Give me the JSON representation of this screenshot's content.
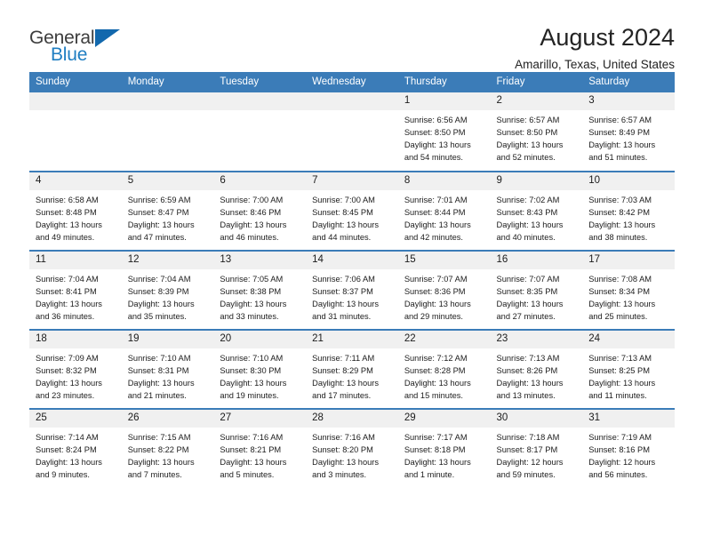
{
  "brand": {
    "name_top": "General",
    "name_bottom": "Blue",
    "triangle_color": "#1268ad",
    "blue_color": "#1f7ec2"
  },
  "header": {
    "title": "August 2024",
    "location": "Amarillo, Texas, United States"
  },
  "theme": {
    "header_bg": "#3b7cb8",
    "header_text": "#ffffff",
    "daynum_bg": "#f0f0f0",
    "cell_bg": "#ffffff",
    "rule_color": "#3b7cb8"
  },
  "calendar": {
    "weekday_headers": [
      "Sunday",
      "Monday",
      "Tuesday",
      "Wednesday",
      "Thursday",
      "Friday",
      "Saturday"
    ],
    "weeks": [
      [
        {
          "day": "",
          "lines": []
        },
        {
          "day": "",
          "lines": []
        },
        {
          "day": "",
          "lines": []
        },
        {
          "day": "",
          "lines": []
        },
        {
          "day": "1",
          "lines": [
            "Sunrise: 6:56 AM",
            "Sunset: 8:50 PM",
            "Daylight: 13 hours and 54 minutes."
          ]
        },
        {
          "day": "2",
          "lines": [
            "Sunrise: 6:57 AM",
            "Sunset: 8:50 PM",
            "Daylight: 13 hours and 52 minutes."
          ]
        },
        {
          "day": "3",
          "lines": [
            "Sunrise: 6:57 AM",
            "Sunset: 8:49 PM",
            "Daylight: 13 hours and 51 minutes."
          ]
        }
      ],
      [
        {
          "day": "4",
          "lines": [
            "Sunrise: 6:58 AM",
            "Sunset: 8:48 PM",
            "Daylight: 13 hours and 49 minutes."
          ]
        },
        {
          "day": "5",
          "lines": [
            "Sunrise: 6:59 AM",
            "Sunset: 8:47 PM",
            "Daylight: 13 hours and 47 minutes."
          ]
        },
        {
          "day": "6",
          "lines": [
            "Sunrise: 7:00 AM",
            "Sunset: 8:46 PM",
            "Daylight: 13 hours and 46 minutes."
          ]
        },
        {
          "day": "7",
          "lines": [
            "Sunrise: 7:00 AM",
            "Sunset: 8:45 PM",
            "Daylight: 13 hours and 44 minutes."
          ]
        },
        {
          "day": "8",
          "lines": [
            "Sunrise: 7:01 AM",
            "Sunset: 8:44 PM",
            "Daylight: 13 hours and 42 minutes."
          ]
        },
        {
          "day": "9",
          "lines": [
            "Sunrise: 7:02 AM",
            "Sunset: 8:43 PM",
            "Daylight: 13 hours and 40 minutes."
          ]
        },
        {
          "day": "10",
          "lines": [
            "Sunrise: 7:03 AM",
            "Sunset: 8:42 PM",
            "Daylight: 13 hours and 38 minutes."
          ]
        }
      ],
      [
        {
          "day": "11",
          "lines": [
            "Sunrise: 7:04 AM",
            "Sunset: 8:41 PM",
            "Daylight: 13 hours and 36 minutes."
          ]
        },
        {
          "day": "12",
          "lines": [
            "Sunrise: 7:04 AM",
            "Sunset: 8:39 PM",
            "Daylight: 13 hours and 35 minutes."
          ]
        },
        {
          "day": "13",
          "lines": [
            "Sunrise: 7:05 AM",
            "Sunset: 8:38 PM",
            "Daylight: 13 hours and 33 minutes."
          ]
        },
        {
          "day": "14",
          "lines": [
            "Sunrise: 7:06 AM",
            "Sunset: 8:37 PM",
            "Daylight: 13 hours and 31 minutes."
          ]
        },
        {
          "day": "15",
          "lines": [
            "Sunrise: 7:07 AM",
            "Sunset: 8:36 PM",
            "Daylight: 13 hours and 29 minutes."
          ]
        },
        {
          "day": "16",
          "lines": [
            "Sunrise: 7:07 AM",
            "Sunset: 8:35 PM",
            "Daylight: 13 hours and 27 minutes."
          ]
        },
        {
          "day": "17",
          "lines": [
            "Sunrise: 7:08 AM",
            "Sunset: 8:34 PM",
            "Daylight: 13 hours and 25 minutes."
          ]
        }
      ],
      [
        {
          "day": "18",
          "lines": [
            "Sunrise: 7:09 AM",
            "Sunset: 8:32 PM",
            "Daylight: 13 hours and 23 minutes."
          ]
        },
        {
          "day": "19",
          "lines": [
            "Sunrise: 7:10 AM",
            "Sunset: 8:31 PM",
            "Daylight: 13 hours and 21 minutes."
          ]
        },
        {
          "day": "20",
          "lines": [
            "Sunrise: 7:10 AM",
            "Sunset: 8:30 PM",
            "Daylight: 13 hours and 19 minutes."
          ]
        },
        {
          "day": "21",
          "lines": [
            "Sunrise: 7:11 AM",
            "Sunset: 8:29 PM",
            "Daylight: 13 hours and 17 minutes."
          ]
        },
        {
          "day": "22",
          "lines": [
            "Sunrise: 7:12 AM",
            "Sunset: 8:28 PM",
            "Daylight: 13 hours and 15 minutes."
          ]
        },
        {
          "day": "23",
          "lines": [
            "Sunrise: 7:13 AM",
            "Sunset: 8:26 PM",
            "Daylight: 13 hours and 13 minutes."
          ]
        },
        {
          "day": "24",
          "lines": [
            "Sunrise: 7:13 AM",
            "Sunset: 8:25 PM",
            "Daylight: 13 hours and 11 minutes."
          ]
        }
      ],
      [
        {
          "day": "25",
          "lines": [
            "Sunrise: 7:14 AM",
            "Sunset: 8:24 PM",
            "Daylight: 13 hours and 9 minutes."
          ]
        },
        {
          "day": "26",
          "lines": [
            "Sunrise: 7:15 AM",
            "Sunset: 8:22 PM",
            "Daylight: 13 hours and 7 minutes."
          ]
        },
        {
          "day": "27",
          "lines": [
            "Sunrise: 7:16 AM",
            "Sunset: 8:21 PM",
            "Daylight: 13 hours and 5 minutes."
          ]
        },
        {
          "day": "28",
          "lines": [
            "Sunrise: 7:16 AM",
            "Sunset: 8:20 PM",
            "Daylight: 13 hours and 3 minutes."
          ]
        },
        {
          "day": "29",
          "lines": [
            "Sunrise: 7:17 AM",
            "Sunset: 8:18 PM",
            "Daylight: 13 hours and 1 minute."
          ]
        },
        {
          "day": "30",
          "lines": [
            "Sunrise: 7:18 AM",
            "Sunset: 8:17 PM",
            "Daylight: 12 hours and 59 minutes."
          ]
        },
        {
          "day": "31",
          "lines": [
            "Sunrise: 7:19 AM",
            "Sunset: 8:16 PM",
            "Daylight: 12 hours and 56 minutes."
          ]
        }
      ]
    ]
  }
}
